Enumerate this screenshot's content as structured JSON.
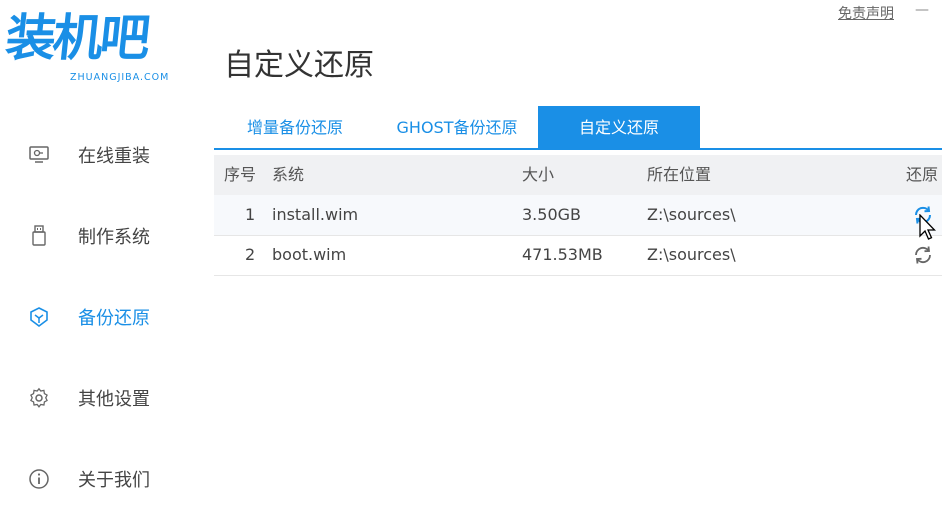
{
  "app": {
    "logo_text": "装机吧",
    "logo_domain": "ZHUANGJIBA.COM",
    "disclaimer": "免责声明",
    "minimize": "—",
    "page_title": "自定义还原"
  },
  "sidebar": {
    "items": [
      {
        "label": "在线重装",
        "icon": "monitor-icon",
        "active": false
      },
      {
        "label": "制作系统",
        "icon": "usb-drive-icon",
        "active": false
      },
      {
        "label": "备份还原",
        "icon": "backup-restore-icon",
        "active": true
      },
      {
        "label": "其他设置",
        "icon": "gear-icon",
        "active": false
      },
      {
        "label": "关于我们",
        "icon": "info-icon",
        "active": false
      }
    ]
  },
  "tabs": [
    {
      "label": "增量备份还原",
      "active": false
    },
    {
      "label": "GHOST备份还原",
      "active": false
    },
    {
      "label": "自定义还原",
      "active": true
    }
  ],
  "table": {
    "headers": {
      "index": "序号",
      "system": "系统",
      "size": "大小",
      "location": "所在位置",
      "restore": "还原"
    },
    "rows": [
      {
        "index": "1",
        "system": "install.wim",
        "size": "3.50GB",
        "location": "Z:\\sources\\"
      },
      {
        "index": "2",
        "system": "boot.wim",
        "size": "471.53MB",
        "location": "Z:\\sources\\"
      }
    ]
  },
  "colors": {
    "accent": "#1a8fe6",
    "text": "#444444",
    "header_bg": "#f0f1f3"
  }
}
